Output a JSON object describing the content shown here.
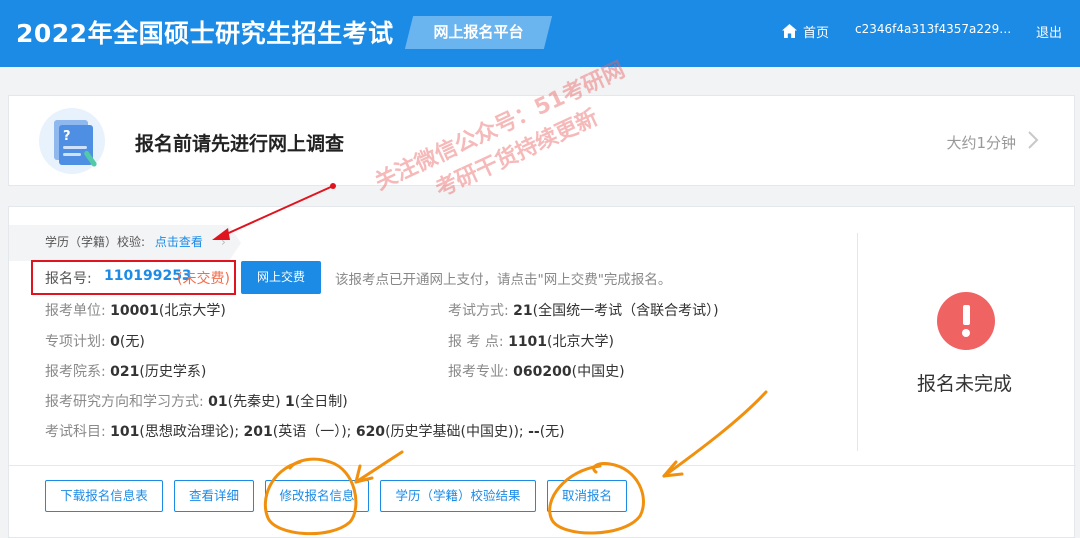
{
  "header": {
    "site_title": "2022年全国硕士研究生招生考试",
    "platform_tag": "网上报名平台",
    "home_label": "首页",
    "user_id": "c2346f4a313f4357a2294...",
    "logout_label": "退出"
  },
  "survey": {
    "title": "报名前请先进行网上调查",
    "time_estimate": "大约1分钟"
  },
  "registration": {
    "verify_label": "学历（学籍）校验:",
    "verify_link": "点击查看",
    "regno_label": "报名号:",
    "regno_value": "110199253",
    "payment_status": "(未交费)",
    "pay_button": "网上交费",
    "pay_hint": "该报考点已开通网上支付，请点击\"网上交费\"完成报名。",
    "fields": {
      "unit_label": "报考单位:",
      "unit_code": "10001",
      "unit_name": "(北京大学)",
      "exam_method_label": "考试方式:",
      "exam_method_code": "21",
      "exam_method_name": "(全国统一考试（含联合考试）)",
      "special_plan_label": "专项计划:",
      "special_plan_code": "0",
      "special_plan_name": "(无)",
      "exam_site_label": "报 考 点:",
      "exam_site_code": "1101",
      "exam_site_name": "(北京大学)",
      "dept_label": "报考院系:",
      "dept_code": "021",
      "dept_name": "(历史学系)",
      "major_label": "报考专业:",
      "major_code": "060200",
      "major_name": "(中国史)",
      "direction_label": "报考研究方向和学习方式:",
      "direction_code": "01",
      "direction_name": "(先秦史)",
      "study_mode_code": "1",
      "study_mode_name": "(全日制)",
      "subjects_label": "考试科目:",
      "subject1_code": "101",
      "subject1_name": "(思想政治理论);",
      "subject2_code": "201",
      "subject2_name": "(英语（一）);",
      "subject3_code": "620",
      "subject3_name": "(历史学基础(中国史));",
      "subject4_code": "--",
      "subject4_name": "(无)"
    },
    "status_text": "报名未完成",
    "buttons": {
      "download": "下载报名信息表",
      "view_details": "查看详细",
      "modify": "修改报名信息",
      "verify_result": "学历（学籍）校验结果",
      "cancel": "取消报名"
    }
  },
  "watermark": {
    "line1": "关注微信公众号：51考研网",
    "line2": "考研干货持续更新"
  },
  "colors": {
    "primary": "#1b8be6",
    "danger": "#ef6363",
    "highlight_box": "#e0141e",
    "annotation_arrow": "#e0141e",
    "annotation_circle": "#f0900e"
  }
}
